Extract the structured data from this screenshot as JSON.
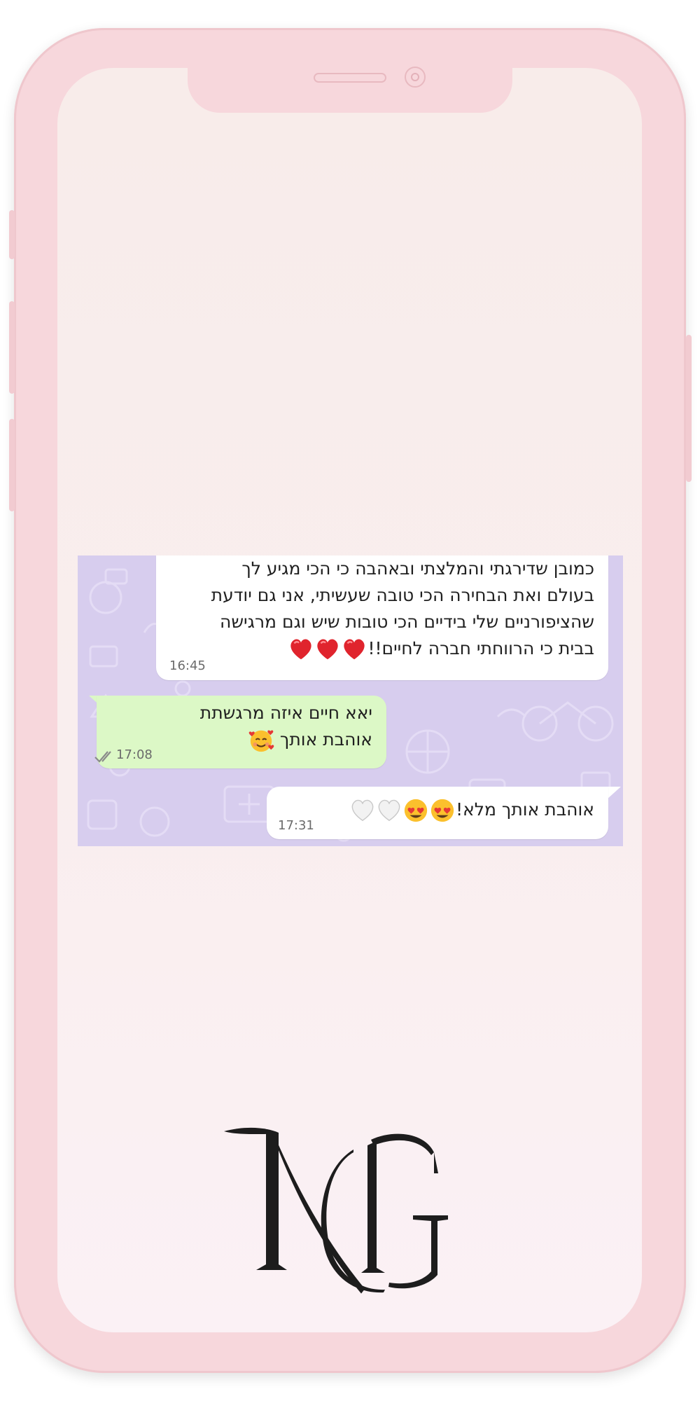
{
  "colors": {
    "phone_frame": "#f7d7dc",
    "screen": "#f9eeee",
    "chat_wallpaper": "#d7cdee",
    "incoming_bubble": "#ffffff",
    "outgoing_bubble": "#dcf8c6",
    "ticks": "#8a8a8a",
    "logo": "#1d1d1d"
  },
  "messages": [
    {
      "direction": "incoming",
      "lines": [
        "כמובן שדירגתי והמלצתי ובאהבה כי הכי מגיע לך",
        "בעולם ואת הבחירה הכי טובה שעשיתי, אני גם יודעת",
        "שהציפורניים שלי בידיים הכי טובות שיש וגם מרגישה",
        "בבית כי הרווחתי חברה לחיים!!"
      ],
      "emoji": [
        "red-heart",
        "red-heart",
        "red-heart"
      ],
      "time": "16:45"
    },
    {
      "direction": "outgoing",
      "lines": [
        "יאא חיים איזה מרגשתת",
        "אוהבת אותך"
      ],
      "emoji": [
        "smiling-face-with-hearts"
      ],
      "time": "17:08",
      "status_icon": "double-check-icon"
    },
    {
      "direction": "incoming",
      "lines": [
        "אוהבת אותך מלא!"
      ],
      "emoji": [
        "heart-eyes",
        "heart-eyes",
        "white-heart",
        "white-heart"
      ],
      "time": "17:31"
    }
  ],
  "logo": {
    "text": "MG",
    "icon": "mg-monogram-logo"
  }
}
